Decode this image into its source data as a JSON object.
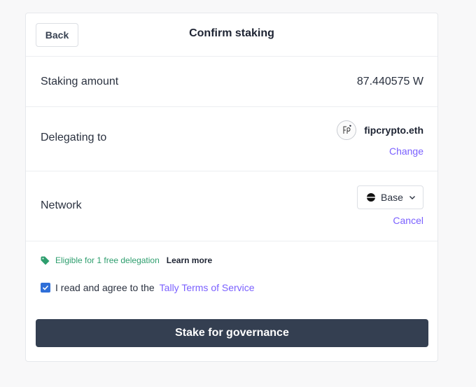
{
  "header": {
    "back_label": "Back",
    "title": "Confirm staking"
  },
  "amount": {
    "label": "Staking amount",
    "value": "87.440575 W"
  },
  "delegate": {
    "label": "Delegating to",
    "name": "fipcrypto.eth",
    "change_label": "Change",
    "avatar_icon": "fip-avatar-with-bird-icon"
  },
  "network": {
    "label": "Network",
    "selected": "Base",
    "network_icon": "base-logo-icon",
    "cancel_label": "Cancel"
  },
  "eligibility": {
    "text": "Eligible for 1 free delegation",
    "learn_more": "Learn more",
    "icon": "tag-icon",
    "color": "#2e9e6e"
  },
  "terms": {
    "checked": true,
    "prefix": "I read and agree to the",
    "link": "Tally Terms of Service"
  },
  "actions": {
    "stake_label": "Stake for governance"
  },
  "colors": {
    "accent": "#7b61ff",
    "button_bg": "#343f51",
    "checkbox": "#2f6fd8"
  }
}
